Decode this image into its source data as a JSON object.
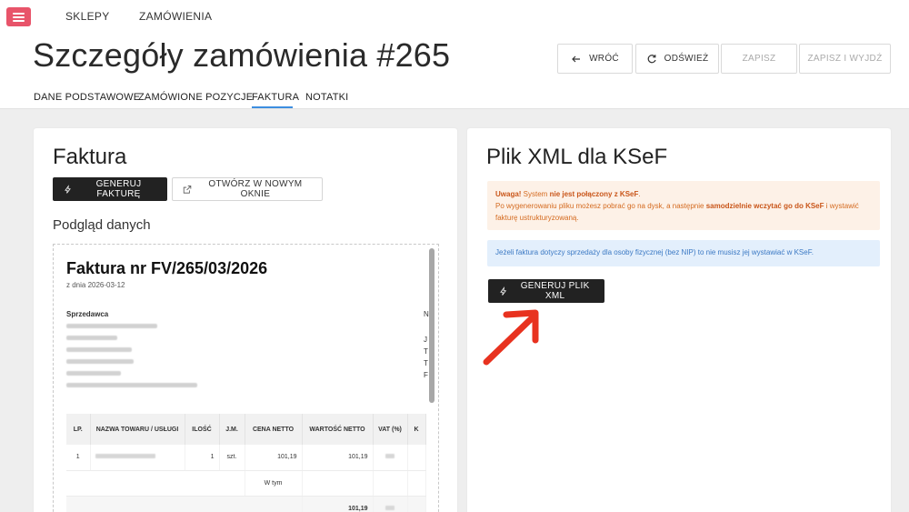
{
  "topnav": {
    "shops": "SKLEPY",
    "orders": "ZAMÓWIENIA"
  },
  "page": {
    "title": "Szczegóły zamówienia #265"
  },
  "toolbar": {
    "back": "WRÓĆ",
    "refresh": "ODŚWIEŻ",
    "save": "ZAPISZ",
    "save_quit": "ZAPISZ I WYJDŹ"
  },
  "tabs": [
    "DANE PODSTAWOWE",
    "ZAMÓWIONE POZYCJE",
    "FAKTURA",
    "NOTATKI"
  ],
  "active_tab": "FAKTURA",
  "invoice_card": {
    "title": "Faktura",
    "generate_label": "GENERUJ FAKTURĘ",
    "open_label": "OTWÓRZ W NOWYM OKNIE",
    "preview_label": "Podgląd danych"
  },
  "preview": {
    "title": "Faktura nr FV/265/03/2026",
    "date": "z dnia 2026-03-12",
    "seller_label": "Sprzedawca",
    "side_chars": [
      "N",
      "J",
      "T",
      "T",
      "F"
    ],
    "table": {
      "headers": [
        "LP.",
        "NAZWA TOWARU / USŁUGI",
        "ILOŚĆ",
        "J.M.",
        "CENA NETTO",
        "WARTOŚĆ NETTO",
        "VAT (%)",
        "K"
      ],
      "row1": {
        "lp": "1",
        "qty": "1",
        "unit": "szt.",
        "price": "101,19",
        "value": "101,19"
      },
      "row2": {
        "label": "W tym"
      },
      "row3": {
        "total": "101,19"
      }
    }
  },
  "xml_card": {
    "title": "Plik XML dla KSeF",
    "warn_prefix": "Uwaga!",
    "warn_text1": " System ",
    "warn_bold1": "nie jest połączony z KSeF",
    "warn_text2": ".",
    "warn_line2a": "Po wygenerowaniu pliku możesz pobrać go na dysk, a następnie ",
    "warn_bold2": "samodzielnie wczytać go do KSeF",
    "warn_line2b": " i wystawić fakturę ustrukturyzowaną.",
    "info_text": "Jeżeli faktura dotyczy sprzedaży dla osoby fizycznej (bez NIP) to nie musisz jej wystawiać w KSeF.",
    "generate_xml_label": "GENERUJ PLIK XML"
  },
  "colors": {
    "menu": "#e8546a",
    "accent_tab": "#3d8ee0",
    "arrow": "#e8321f",
    "dark_button": "#222222"
  },
  "icons": [
    "menu-icon",
    "arrow-left-icon",
    "refresh-icon",
    "bolt-icon",
    "external-link-icon",
    "arrow-annotation-icon"
  ]
}
